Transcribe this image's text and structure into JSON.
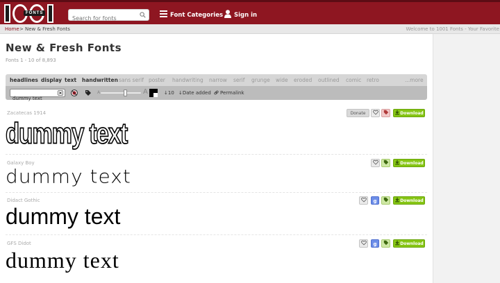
{
  "header": {
    "logo_text": "FONTS",
    "search_placeholder": "Search for fonts",
    "nav": {
      "categories": "Font Categories",
      "sign_in": "Sign in"
    }
  },
  "breadcrumb": {
    "home": "Home",
    "separator": ">",
    "current": "New & Fresh Fonts",
    "welcome": "Welcome to 1001 Fonts - Your Favorite"
  },
  "page": {
    "title": "New & Fresh Fonts",
    "count": "Fonts 1 - 10 of 8,893"
  },
  "filters": [
    {
      "label": "headlines",
      "active": true
    },
    {
      "label": "display",
      "active": true
    },
    {
      "label": "text",
      "active": true
    },
    {
      "label": "handwritten",
      "active": true
    },
    {
      "label": "sans serif",
      "active": false
    },
    {
      "label": "poster",
      "active": false
    },
    {
      "label": "handwriting",
      "active": false
    },
    {
      "label": "narrow",
      "active": false
    },
    {
      "label": "serif",
      "active": false
    },
    {
      "label": "grunge",
      "active": false
    },
    {
      "label": "wide",
      "active": false
    },
    {
      "label": "eroded",
      "active": false
    },
    {
      "label": "outlined",
      "active": false
    },
    {
      "label": "comic",
      "active": false
    },
    {
      "label": "retro",
      "active": false
    },
    {
      "label": "...more",
      "active": false
    }
  ],
  "toolbar": {
    "preview_text": "dummy text",
    "count_label": "10",
    "sort_label": "Date added",
    "permalink_label": "Permalink",
    "size_small": "A",
    "size_large": "A"
  },
  "fonts": [
    {
      "name": "Zacatecas 1914",
      "sample": "dummy text",
      "donate": "Donate",
      "download": "Download"
    },
    {
      "name": "Galaxy Boy",
      "sample": "dummy text",
      "download": "Download"
    },
    {
      "name": "Didact Gothic",
      "sample": "dummy text",
      "google": "g",
      "download": "Download"
    },
    {
      "name": "GFS Didot",
      "sample": "dummy text",
      "google": "g",
      "download": "Download"
    }
  ],
  "colors": {
    "header": "#8e1621",
    "link": "#8e1621",
    "download": "#86c514"
  }
}
